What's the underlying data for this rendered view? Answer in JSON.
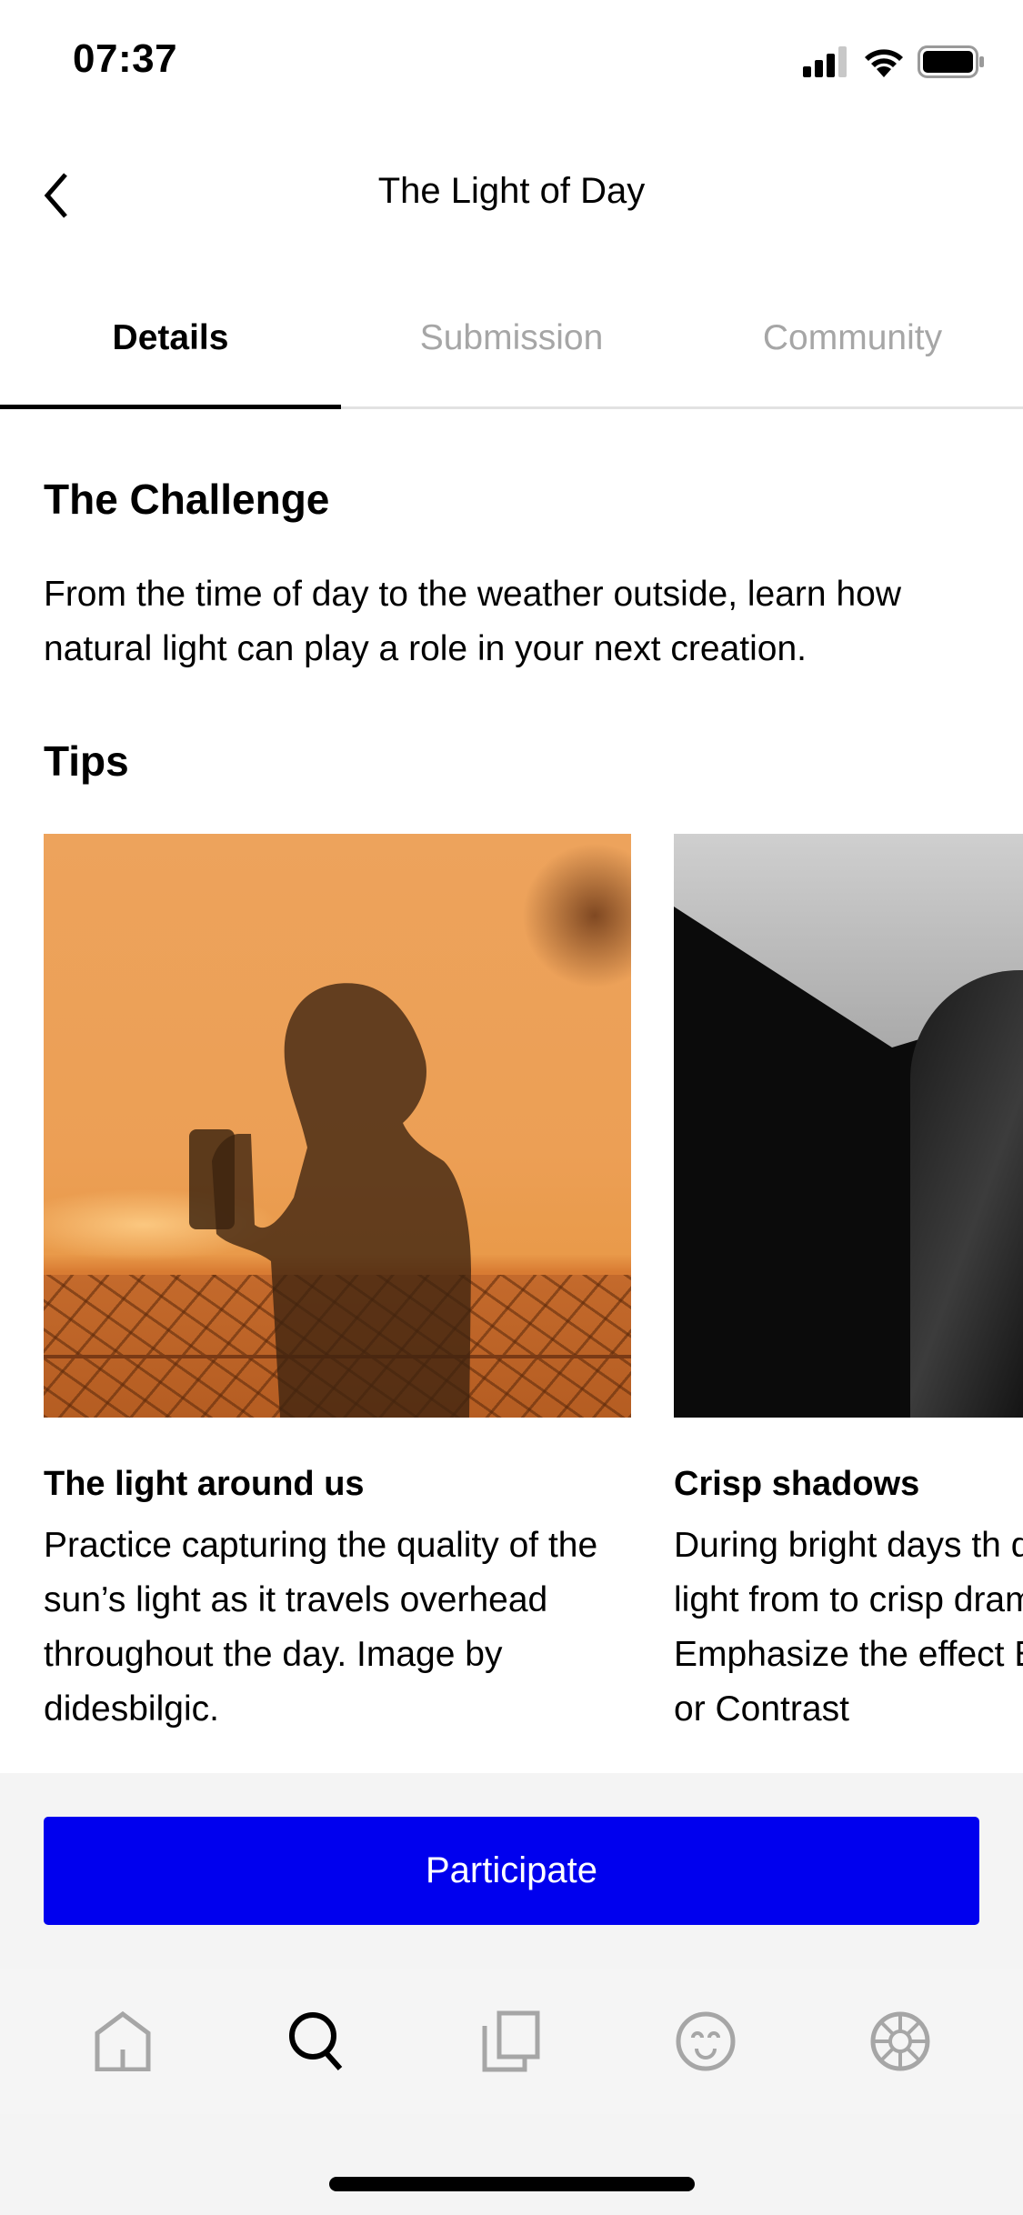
{
  "status_bar": {
    "time": "07:37",
    "icons": [
      "cellular-signal-icon",
      "wifi-icon",
      "battery-icon"
    ]
  },
  "nav": {
    "back_icon": "chevron-left-icon",
    "title": "The Light of Day"
  },
  "tabs": [
    {
      "label": "Details",
      "active": true
    },
    {
      "label": "Submission",
      "active": false
    },
    {
      "label": "Community",
      "active": false
    }
  ],
  "challenge": {
    "heading": "The Challenge",
    "body": "From the time of day to the weather outside, learn how natural light can play a role in your next creation."
  },
  "tips": {
    "heading": "Tips",
    "cards": [
      {
        "title": "The light around us",
        "description": "Practice capturing the quality of the sun’s light as it travels overhead throughout the day. Image by didesbilgic.",
        "image": "silhouette-on-orange-wall-photo"
      },
      {
        "title": "Crisp shadows",
        "description": "During bright days th directional light from to crisp dramatic sha Emphasize the effect Exposure or Contrast",
        "image": "person-in-leather-jacket-photo"
      }
    ]
  },
  "actions": {
    "participate_label": "Participate"
  },
  "tab_bar": {
    "items": [
      {
        "icon": "home-icon",
        "active": false
      },
      {
        "icon": "search-icon",
        "active": true
      },
      {
        "icon": "gallery-icon",
        "active": false
      },
      {
        "icon": "smiley-icon",
        "active": false
      },
      {
        "icon": "wheel-icon",
        "active": false
      }
    ]
  },
  "colors": {
    "accent": "#0000ee",
    "inactive": "#a6a6a6",
    "footer_bg": "#f4f4f4"
  }
}
